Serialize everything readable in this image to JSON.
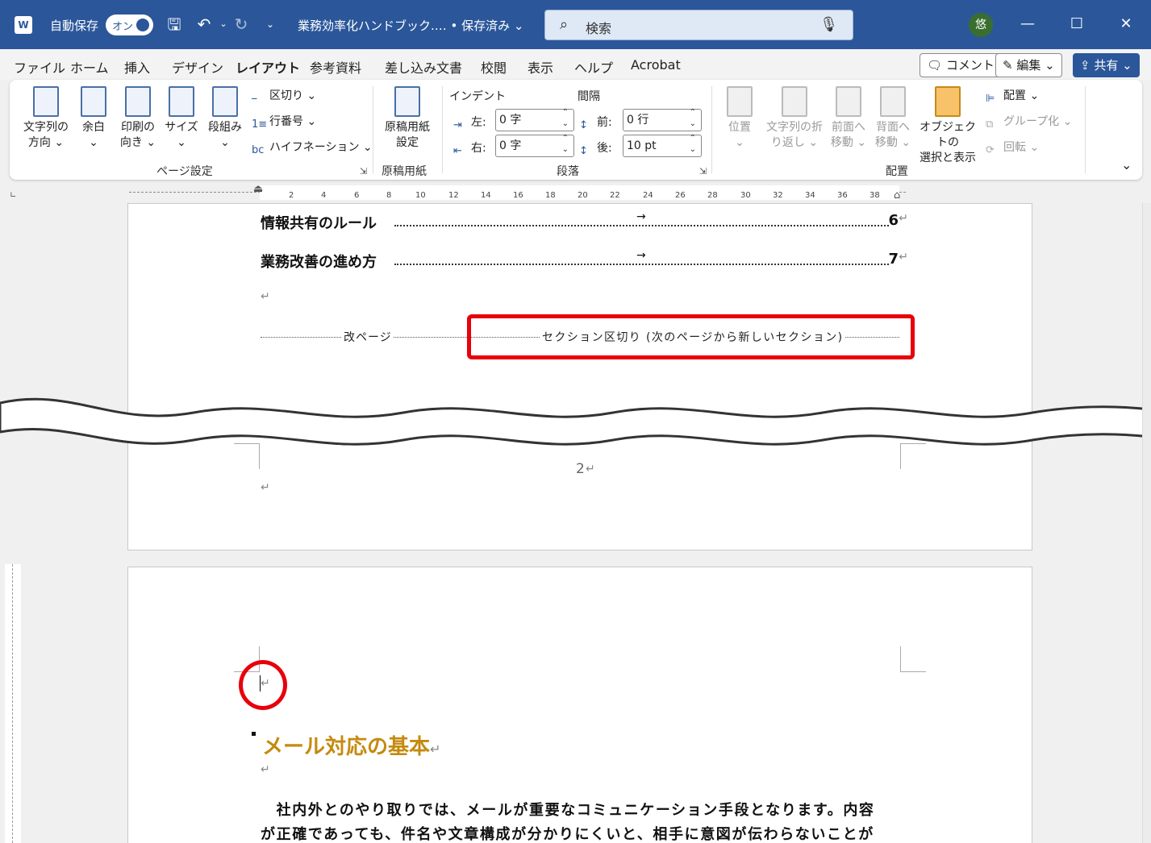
{
  "titlebar": {
    "autosave_label": "自動保存",
    "autosave_state": "オン",
    "doc_title": "業務効率化ハンドブック.… • 保存済み ⌄",
    "search_placeholder": "検索",
    "app_icon": "W",
    "avatar_text": "悠"
  },
  "menu": {
    "tabs": [
      "ファイル",
      "ホーム",
      "挿入",
      "デザイン",
      "レイアウト",
      "参考資料",
      "差し込み文書",
      "校閲",
      "表示",
      "ヘルプ",
      "Acrobat"
    ],
    "active_tab": "レイアウト",
    "comment_label": "コメント",
    "edit_label": "編集 ⌄",
    "share_label": "共有 ⌄"
  },
  "ribbon": {
    "page_setup": {
      "text_direction": "文字列の\n方向 ⌄",
      "margins": "余白\n⌄",
      "orientation": "印刷の\n向き ⌄",
      "size": "サイズ\n⌄",
      "columns": "段組み\n⌄",
      "breaks": "区切り ⌄",
      "line_numbers": "行番号 ⌄",
      "hyphenation": "ハイフネーション ⌄",
      "group_label": "ページ設定"
    },
    "manuscript": {
      "button": "原稿用紙\n設定",
      "group_label": "原稿用紙"
    },
    "paragraph": {
      "indent_header": "インデント",
      "spacing_header": "間隔",
      "left_label": "左:",
      "left_value": "0 字",
      "right_label": "右:",
      "right_value": "0 字",
      "before_label": "前:",
      "before_value": "0 行",
      "after_label": "後:",
      "after_value": "10 pt",
      "group_label": "段落"
    },
    "arrange": {
      "position": "位置\n⌄",
      "wrap_text": "文字列の折\nり返し ⌄",
      "bring_forward": "前面へ\n移動 ⌄",
      "send_backward": "背面へ\n移動 ⌄",
      "selection_pane": "オブジェクトの\n選択と表示",
      "align": "配置 ⌄",
      "group": "グループ化 ⌄",
      "rotate": "回転 ⌄",
      "group_label": "配置"
    }
  },
  "ruler": {
    "ticks": [
      "2",
      "4",
      "6",
      "8",
      "10",
      "12",
      "14",
      "16",
      "18",
      "20",
      "22",
      "24",
      "26",
      "28",
      "30",
      "32",
      "34",
      "36",
      "38"
    ]
  },
  "document": {
    "toc": [
      {
        "title": "情報共有のルール",
        "page": "6"
      },
      {
        "title": "業務改善の進め方",
        "page": "7"
      }
    ],
    "para_mark": "↵",
    "page_break_label": "改ページ",
    "section_break_label": "セクション区切り (次のページから新しいセクション)",
    "page_number": "2",
    "heading": "メール対応の基本",
    "body_lines": [
      "　社内外とのやり取りでは、メールが重要なコミュニケーション手段となります。内容",
      "が正確であっても、件名や文章構成が分かりにくいと、相手に意図が伝わらないことが"
    ]
  },
  "colors": {
    "title_bar": "#2b579a",
    "highlight": "#e8000b",
    "heading": "#c58a0f"
  }
}
